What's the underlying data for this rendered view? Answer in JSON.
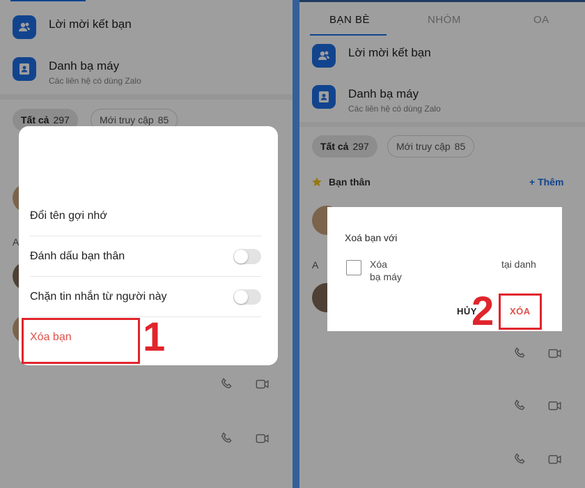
{
  "left": {
    "list": [
      {
        "title": "Lời mời kết bạn",
        "subtitle": "",
        "icon": "contacts-icon"
      },
      {
        "title": "Danh bạ máy",
        "subtitle": "Các liên hệ có dùng Zalo",
        "icon": "phonebook-icon"
      }
    ],
    "filters": {
      "all_label": "Tất cả",
      "all_count": "297",
      "recent_label": "Mới truy cập",
      "recent_count": "85"
    },
    "group_letter": "A",
    "menu": {
      "rename": "Đổi tên gợi nhớ",
      "mark_close": "Đánh dấu bạn thân",
      "mark_close_on": false,
      "block_msgs": "Chặn tin nhắn từ người này",
      "block_msgs_on": false,
      "remove_friend": "Xóa bạn"
    },
    "step": "1"
  },
  "right": {
    "tabs": [
      {
        "label": "BẠN BÈ",
        "active": true
      },
      {
        "label": "NHÓM",
        "active": false
      },
      {
        "label": "OA",
        "active": false
      }
    ],
    "list": [
      {
        "title": "Lời mời kết bạn",
        "subtitle": "",
        "icon": "contacts-icon"
      },
      {
        "title": "Danh bạ máy",
        "subtitle": "Các liên hệ có dùng Zalo",
        "icon": "phonebook-icon"
      }
    ],
    "filters": {
      "all_label": "Tất cả",
      "all_count": "297",
      "recent_label": "Mới truy cập",
      "recent_count": "85"
    },
    "close_friends": {
      "title": "Bạn thân",
      "add": "+ Thêm"
    },
    "group_letter": "A",
    "dialog": {
      "title": "Xoá bạn với",
      "checkbox_line1": "Xóa",
      "checkbox_line2": "bạ máy",
      "checkbox_tail": "tại danh",
      "checked": false,
      "cancel": "HỦY",
      "confirm": "XÓA"
    },
    "step": "2"
  },
  "colors": {
    "accent": "#1a6fe6",
    "danger": "#e0504a",
    "marker": "#e0252c"
  }
}
